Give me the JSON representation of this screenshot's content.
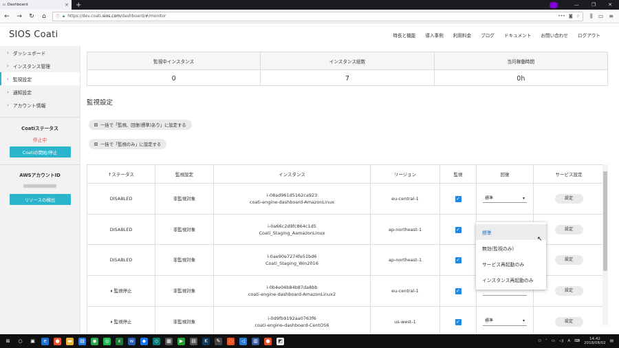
{
  "browser": {
    "tab_title": "Dashboard",
    "url_prefix": "https://dev.coati.",
    "url_domain": "sios.com",
    "url_path": "/dashboard/#/monitor"
  },
  "header": {
    "logo": "SIOS Coati",
    "nav": [
      "特長と機能",
      "導入事例",
      "利用料金",
      "ブログ",
      "ドキュメント",
      "お問い合わせ",
      "ログアウト"
    ]
  },
  "sidebar": {
    "items": [
      "ダッシュボード",
      "インスタンス管理",
      "監視設定",
      "通知設定",
      "アカウント情報"
    ],
    "active_index": 2,
    "coati_status_title": "Coatiステータス",
    "coati_status_value": "停止中",
    "coati_toggle_button": "Coatiの開始/停止",
    "aws_title": "AWSアカウントID",
    "resource_button": "リソースの検出"
  },
  "stats": [
    {
      "label": "監視中インスタンス",
      "value": "0"
    },
    {
      "label": "インスタンス総数",
      "value": "7"
    },
    {
      "label": "当月稼働時間",
      "value": "0h"
    }
  ],
  "section_title": "監視設定",
  "bulk_buttons": [
    "一括で「監視、回復(標準)あり」に設定する",
    "一括で「監視のみ」に設定する"
  ],
  "table": {
    "headers": [
      "↑ステータス",
      "監視設定",
      "インスタンス",
      "リージョン",
      "監視",
      "回復",
      "サービス設定"
    ],
    "rows": [
      {
        "status": "DISABLED",
        "monitor_setting": "非監視対象",
        "instance_id": "i-08ad961d5162ca923",
        "instance_name": "coati-engine-dashboard-AmazonLinux",
        "region": "eu-central-1",
        "recovery": "標準",
        "service_button": "設定"
      },
      {
        "status": "DISABLED",
        "monitor_setting": "非監視対象",
        "instance_id": "i-0a66c2d9fc864c1d5",
        "instance_name": "Coati_Staging_AamazonLinux",
        "region": "ap-northeast-1",
        "recovery": "",
        "service_button": "設定"
      },
      {
        "status": "DISABLED",
        "monitor_setting": "非監視対象",
        "instance_id": "i-0ae90e7274fe51bd6",
        "instance_name": "Coati_Staging_Win2016",
        "region": "ap-northeast-1",
        "recovery": "",
        "service_button": "設定"
      },
      {
        "status": "⏸ 監視停止",
        "monitor_setting": "非監視対象",
        "instance_id": "i-0b4e04b84b87da8bb",
        "instance_name": "coati-engine-dashboard-AmazonLinux2",
        "region": "eu-central-1",
        "recovery": "",
        "service_button": "設定"
      },
      {
        "status": "⏸ 監視停止",
        "monitor_setting": "非監視対象",
        "instance_id": "i-0d9fb9192aa0763f6",
        "instance_name": "coati-engine-dashboard-CentOS6",
        "region": "us-west-1",
        "recovery": "標準",
        "service_button": "設定"
      }
    ]
  },
  "dropdown_options": [
    "標準",
    "無効(監視のみ)",
    "サービス再起動のみ",
    "インスタンス再起動のみ"
  ],
  "taskbar": {
    "time": "14:42",
    "date": "2018/08/02"
  }
}
